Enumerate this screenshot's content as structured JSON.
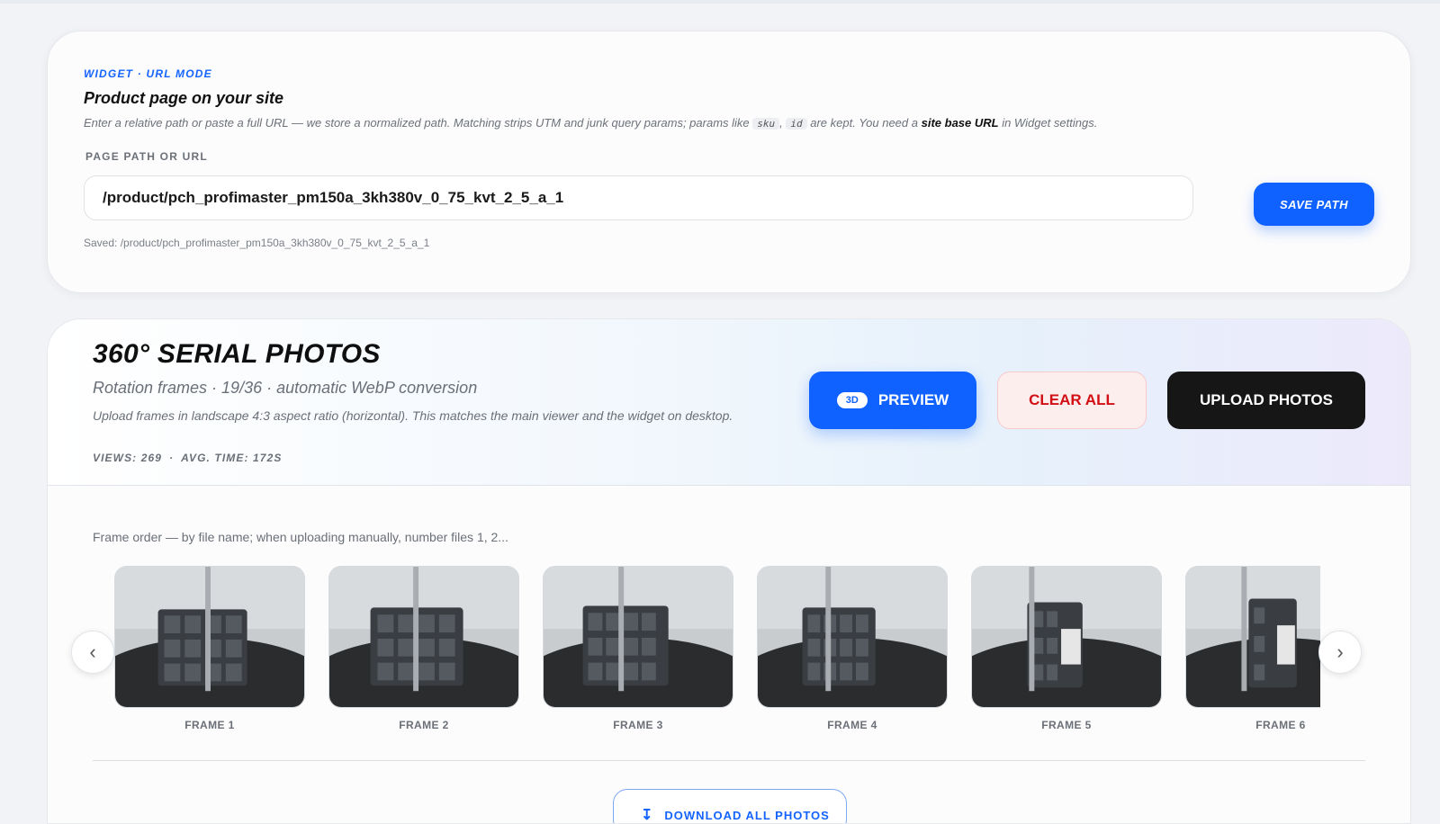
{
  "url_mode": {
    "kicker": "WIDGET · URL MODE",
    "title": "Product page on your site",
    "desc_pre": "Enter a relative path or paste a full URL — we store a normalized path. Matching strips UTM and junk query params; params like ",
    "code1": "sku",
    "desc_sep": ", ",
    "code2": "id",
    "desc_mid": " are kept. You need a ",
    "desc_bold": "site base URL",
    "desc_post": " in Widget settings.",
    "field_label": "PAGE PATH OR URL",
    "path_value": "/product/pch_profimaster_pm150a_3kh380v_0_75_kvt_2_5_a_1",
    "save_button": "SAVE PATH",
    "saved_note": "Saved: /product/pch_profimaster_pm150a_3kh380v_0_75_kvt_2_5_a_1"
  },
  "serial": {
    "title": "360° SERIAL PHOTOS",
    "subtitle": "Rotation frames · 19/36 · automatic WebP conversion",
    "note": "Upload frames in landscape 4:3 aspect ratio (horizontal). This matches the main viewer and the widget on desktop.",
    "views": "VIEWS: 269",
    "stats_sep": "·",
    "avg_time": "AVG. TIME: 172S",
    "preview_badge": "3D",
    "preview_button": "PREVIEW",
    "clear_button": "CLEAR ALL",
    "upload_button": "UPLOAD PHOTOS",
    "frame_order": "Frame order — by file name; when uploading manually, number files 1, 2...",
    "frames": [
      "FRAME 1",
      "FRAME 2",
      "FRAME 3",
      "FRAME 4",
      "FRAME 5",
      "FRAME 6"
    ],
    "prev_icon": "chevron-left-icon",
    "next_icon": "chevron-right-icon",
    "download_button": "DOWNLOAD ALL PHOTOS"
  },
  "colors": {
    "accent": "#0f62ff",
    "danger": "#d10f14",
    "dark": "#161616"
  }
}
